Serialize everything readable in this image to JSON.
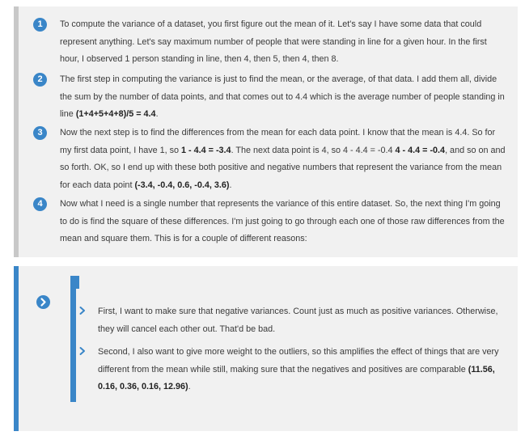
{
  "steps": [
    {
      "num": "1",
      "text": "To compute the variance of a dataset, you first figure out the mean of it. Let's say I have some data that could represent anything. Let's say maximum number of people that were standing in line for a given hour. In the first hour, I observed 1 person standing in line, then 4, then 5, then 4, then 8."
    },
    {
      "num": "2",
      "text_before": "The first step in computing the variance is just to find the mean, or the average, of that data. I add them all, divide the sum by the number of data points, and that comes out to 4.4 which is the average number of people standing in line ",
      "bold": "(1+4+5+4+8)/5 = 4.4",
      "text_after": "."
    },
    {
      "num": "3",
      "text_a": "Now the next step is to find the differences from the mean for each data point. I know that the mean is 4.4. So for my first data point, I have 1, so ",
      "bold_a": "1 - 4.4 = -3.4",
      "text_b": ". The next data point is 4, so 4 - 4.4 = -0.4 ",
      "bold_b": "4 - 4.4 = -0.4",
      "text_c": ", and so on and so forth. OK, so I end up with these both positive and negative numbers that represent the variance from the mean for each data point ",
      "bold_c": "(-3.4, -0.4, 0.6, -0.4, 3.6)",
      "text_d": "."
    },
    {
      "num": "4",
      "text": "Now what I need is a single number that represents the variance of this entire dataset. So, the next thing I'm going to do is find the square of these differences. I'm just going to go through each one of those raw differences from the mean and square them. This is for a couple of different reasons:"
    }
  ],
  "bullets": [
    {
      "text": "First, I want to make sure that negative variances. Count just as much as positive variances. Otherwise, they will cancel each other out. That'd be bad."
    },
    {
      "text": "Second, I also want to give more weight to the outliers, so this amplifies the effect of things that are very different from the mean while still, making sure that the negatives and positives are comparable ",
      "bold": "(11.56, 0.16, 0.36, 0.16, 12.96)",
      "text_after": "."
    }
  ],
  "colors": {
    "accent": "#3a86c8",
    "card_bg": "#f1f1f1",
    "card1_border": "#c8c8c8"
  },
  "icons": {
    "card2_badge": "chevron-right-icon",
    "bullet": "chevron-right-icon"
  }
}
